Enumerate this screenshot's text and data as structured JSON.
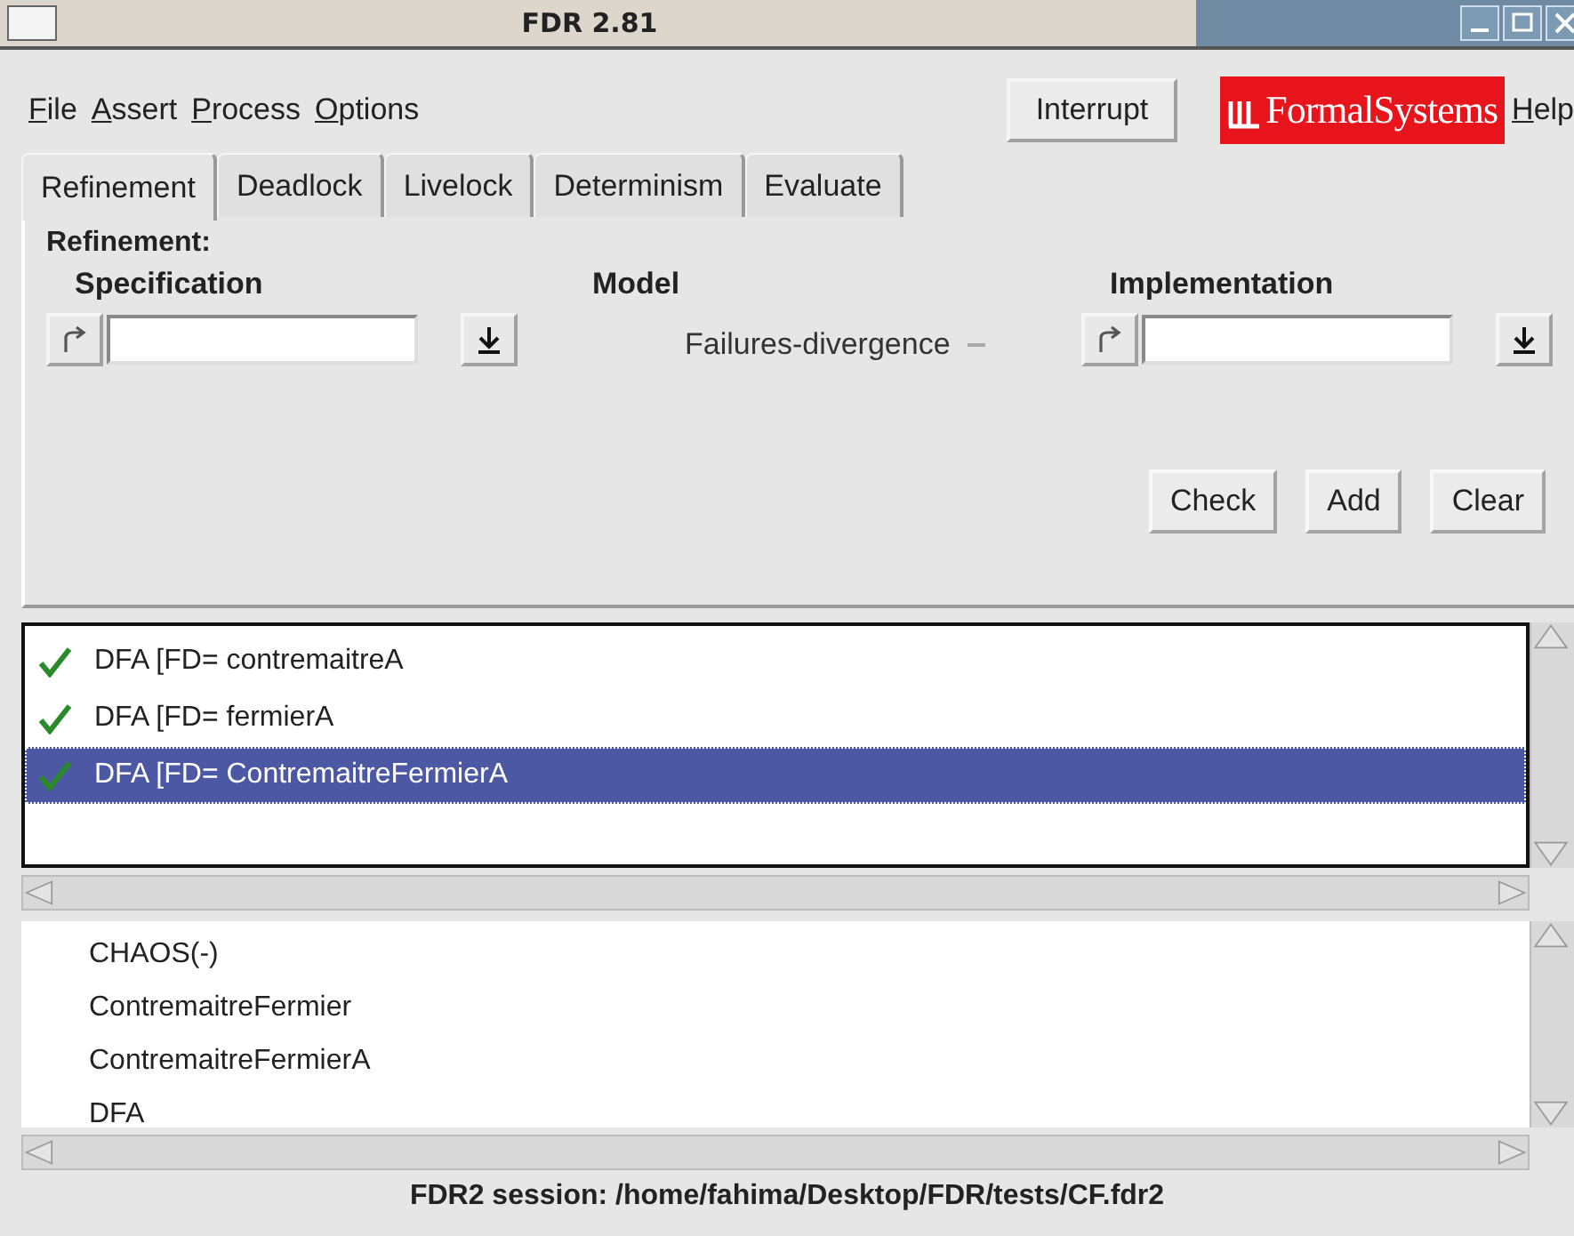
{
  "window": {
    "title": "FDR 2.81"
  },
  "menu": [
    {
      "label": "File"
    },
    {
      "label": "Assert"
    },
    {
      "label": "Process"
    },
    {
      "label": "Options"
    }
  ],
  "interrupt_button": "Interrupt",
  "logo": "FormalSystems",
  "help_menu": "Help",
  "tabs": [
    {
      "label": "Refinement",
      "selected": true
    },
    {
      "label": "Deadlock",
      "selected": false
    },
    {
      "label": "Livelock",
      "selected": false
    },
    {
      "label": "Determinism",
      "selected": false
    },
    {
      "label": "Evaluate",
      "selected": false
    }
  ],
  "panel": {
    "title": "Refinement:",
    "specification_label": "Specification",
    "model_label": "Model",
    "model_value": "Failures-divergence",
    "implementation_label": "Implementation",
    "buttons": [
      "Check",
      "Add",
      "Clear"
    ]
  },
  "assertions": [
    {
      "text": "DFA [FD= contremaitreA",
      "checked": true,
      "selected": false
    },
    {
      "text": "DFA [FD= fermierA",
      "checked": true,
      "selected": false
    },
    {
      "text": "DFA [FD= ContremaitreFermierA",
      "checked": true,
      "selected": true
    }
  ],
  "processes": [
    {
      "text": "CHAOS(-)"
    },
    {
      "text": "ContremaitreFermier"
    },
    {
      "text": "ContremaitreFermierA"
    },
    {
      "text": "DFA"
    }
  ],
  "status_bar": "FDR2 session: /home/fahima/Desktop/FDR/tests/CF.fdr2"
}
